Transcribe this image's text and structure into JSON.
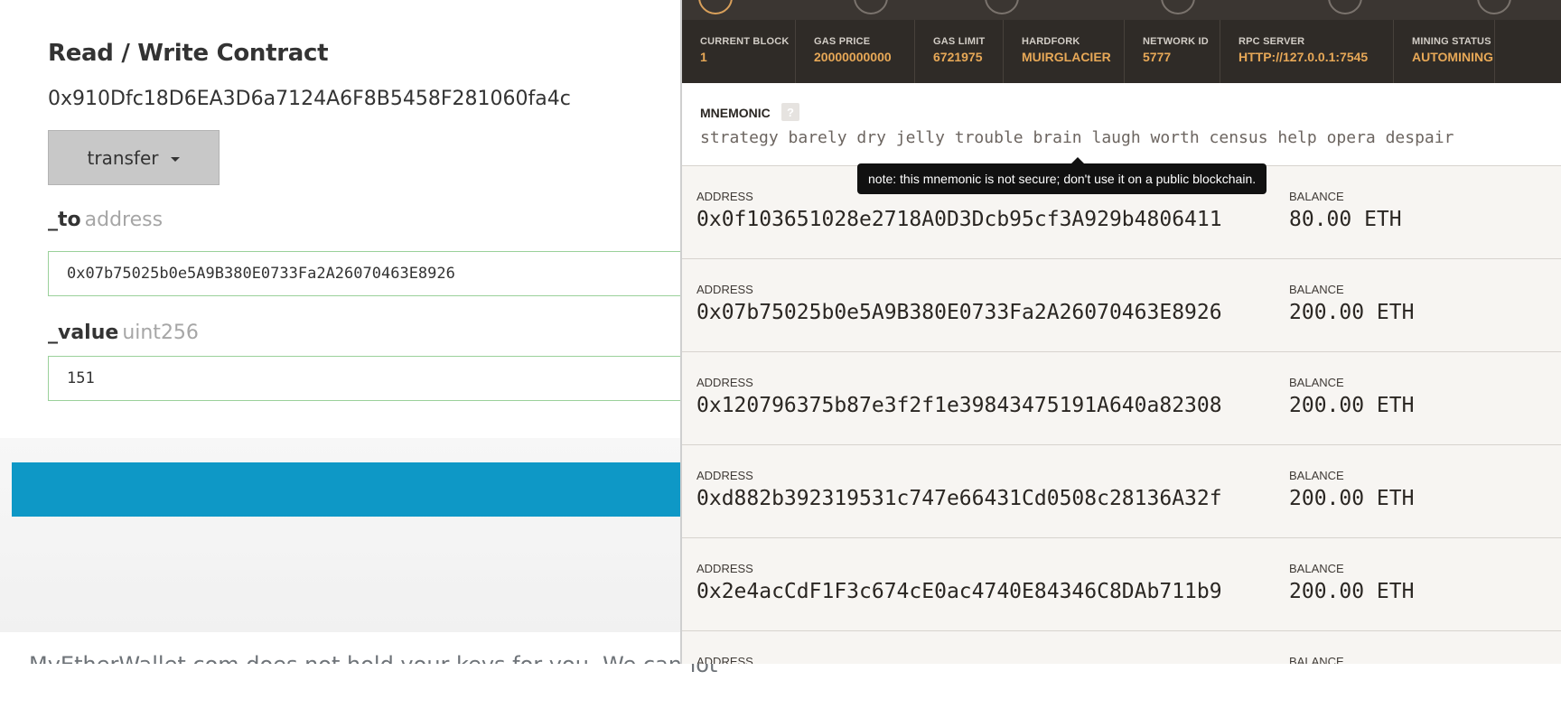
{
  "contract": {
    "title": "Read / Write Contract",
    "address": "0x910Dfc18D6EA3D6a7124A6F8B5458F281060fa4c",
    "selected_function": "transfer",
    "params": [
      {
        "name": "_to",
        "type": "address",
        "value": "0x07b75025b0e5A9B380E0733Fa2A26070463E8926"
      },
      {
        "name": "_value",
        "type": "uint256",
        "value": "151"
      }
    ],
    "footer_text": "MyEtherWallet.com does not hold your keys for you. We cannot"
  },
  "ganache": {
    "status": {
      "current_block": {
        "label": "CURRENT BLOCK",
        "value": "1"
      },
      "gas_price": {
        "label": "GAS PRICE",
        "value": "20000000000"
      },
      "gas_limit": {
        "label": "GAS LIMIT",
        "value": "6721975"
      },
      "hardfork": {
        "label": "HARDFORK",
        "value": "MUIRGLACIER"
      },
      "network_id": {
        "label": "NETWORK ID",
        "value": "5777"
      },
      "rpc_server": {
        "label": "RPC SERVER",
        "value": "HTTP://127.0.0.1:7545"
      },
      "mining_status": {
        "label": "MINING STATUS",
        "value": "AUTOMINING"
      }
    },
    "mnemonic": {
      "label": "MNEMONIC",
      "help_glyph": "?",
      "words": "strategy barely dry jelly trouble brain laugh worth census help opera despair"
    },
    "tooltip": "note: this mnemonic is not secure; don't use it on a public blockchain.",
    "address_label": "ADDRESS",
    "balance_label": "BALANCE",
    "accounts": [
      {
        "address": "0x0f103651028e2718A0D3Dcb95cf3A929b4806411",
        "balance": "80.00 ETH"
      },
      {
        "address": "0x07b75025b0e5A9B380E0733Fa2A26070463E8926",
        "balance": "200.00 ETH"
      },
      {
        "address": "0x120796375b87e3f2f1e39843475191A640a82308",
        "balance": "200.00 ETH"
      },
      {
        "address": "0xd882b392319531c747e66431Cd0508c28136A32f",
        "balance": "200.00 ETH"
      },
      {
        "address": "0x2e4acCdF1F3c674cE0ac4740E84346C8DAb711b9",
        "balance": "200.00 ETH"
      }
    ]
  },
  "colors": {
    "action_bar": "#0e98c6",
    "status_value": "#e7a857",
    "input_border": "#9ad19a"
  }
}
